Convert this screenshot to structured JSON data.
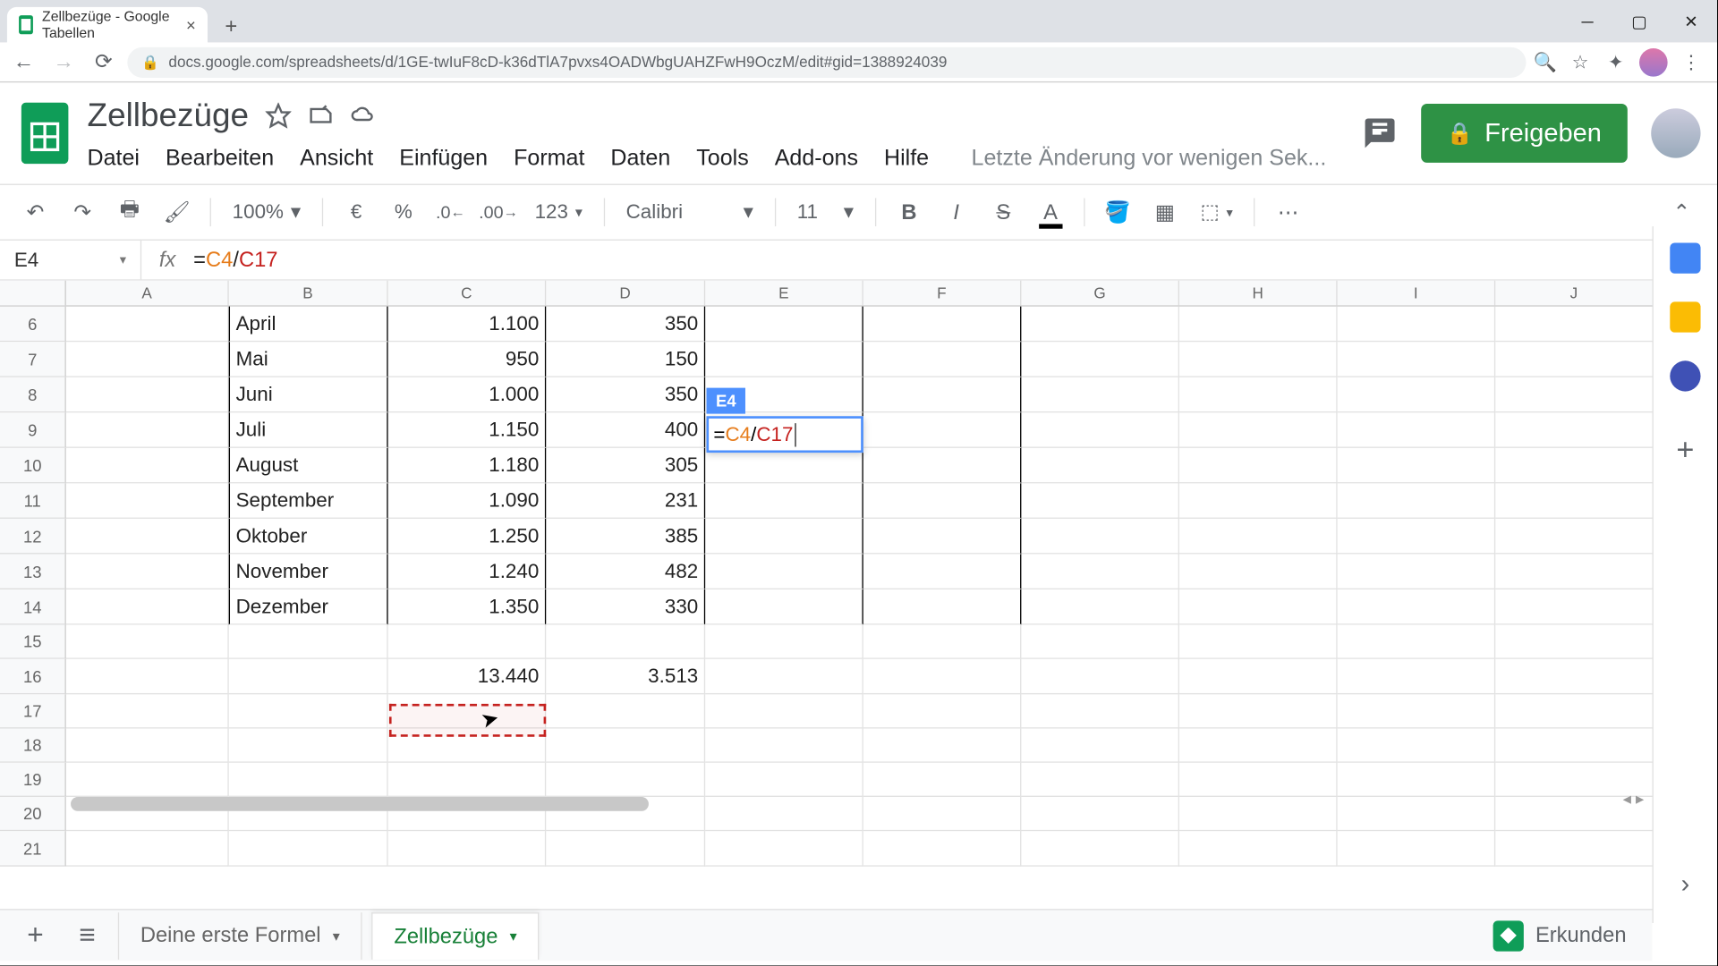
{
  "browser": {
    "tab_title": "Zellbezüge - Google Tabellen",
    "url": "docs.google.com/spreadsheets/d/1GE-twIuF8cD-k36dTlA7pvxs4OADWbgUAHZFwH9OczM/edit#gid=1388924039"
  },
  "doc": {
    "title": "Zellbezüge",
    "last_edit": "Letzte Änderung vor wenigen Sek..."
  },
  "menus": [
    "Datei",
    "Bearbeiten",
    "Ansicht",
    "Einfügen",
    "Format",
    "Daten",
    "Tools",
    "Add-ons",
    "Hilfe"
  ],
  "share_label": "Freigeben",
  "toolbar": {
    "zoom": "100%",
    "number_format": "123",
    "font": "Calibri",
    "font_size": "11"
  },
  "formula_bar": {
    "cell_ref": "E4",
    "formula_prefix": "=",
    "ref1": "C4",
    "sep": "/",
    "ref2": "C17"
  },
  "columns": [
    "A",
    "B",
    "C",
    "D",
    "E",
    "F",
    "G",
    "H",
    "I",
    "J"
  ],
  "rows": [
    {
      "n": "6",
      "b": "April",
      "c": "1.100",
      "d": "350"
    },
    {
      "n": "7",
      "b": "Mai",
      "c": "950",
      "d": "150"
    },
    {
      "n": "8",
      "b": "Juni",
      "c": "1.000",
      "d": "350"
    },
    {
      "n": "9",
      "b": "Juli",
      "c": "1.150",
      "d": "400"
    },
    {
      "n": "10",
      "b": "August",
      "c": "1.180",
      "d": "305"
    },
    {
      "n": "11",
      "b": "September",
      "c": "1.090",
      "d": "231"
    },
    {
      "n": "12",
      "b": "Oktober",
      "c": "1.250",
      "d": "385"
    },
    {
      "n": "13",
      "b": "November",
      "c": "1.240",
      "d": "482"
    },
    {
      "n": "14",
      "b": "Dezember",
      "c": "1.350",
      "d": "330"
    },
    {
      "n": "15",
      "b": "",
      "c": "",
      "d": ""
    },
    {
      "n": "16",
      "b": "",
      "c": "13.440",
      "d": "3.513"
    },
    {
      "n": "17",
      "b": "",
      "c": "",
      "d": ""
    },
    {
      "n": "18",
      "b": "",
      "c": "",
      "d": ""
    },
    {
      "n": "19",
      "b": "",
      "c": "",
      "d": ""
    },
    {
      "n": "20",
      "b": "",
      "c": "",
      "d": ""
    },
    {
      "n": "21",
      "b": "",
      "c": "",
      "d": ""
    }
  ],
  "edit_overlay": {
    "label": "E4",
    "prefix": "=",
    "ref1": "C4",
    "sep": "/",
    "ref2": "C17"
  },
  "sheet_tabs": {
    "inactive": "Deine erste Formel",
    "active": "Zellbezüge"
  },
  "explore_label": "Erkunden"
}
